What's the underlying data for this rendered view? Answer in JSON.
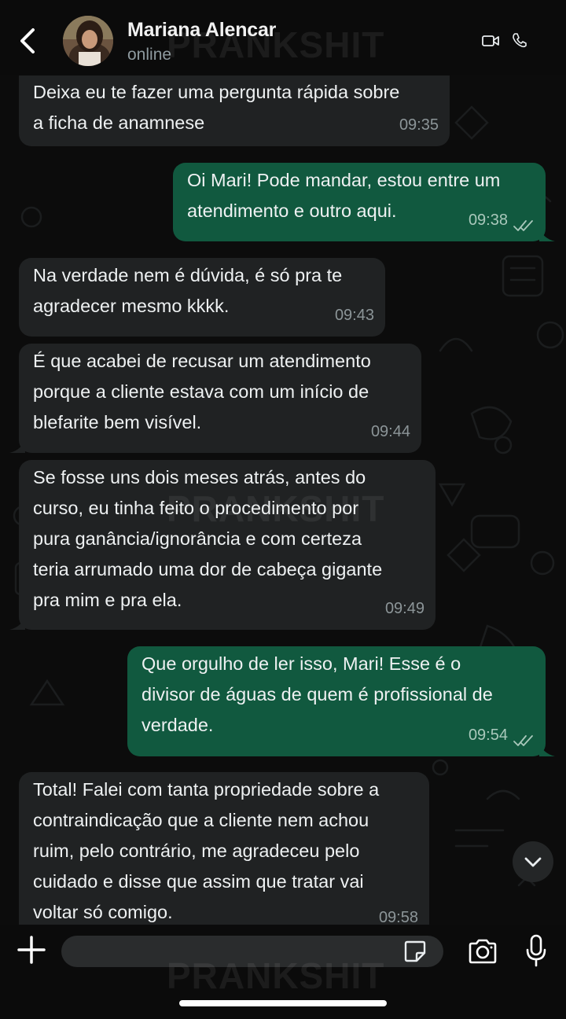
{
  "header": {
    "contact_name": "Mariana Alencar",
    "status": "online"
  },
  "watermark": "PRANKSHIT",
  "messages": [
    {
      "direction": "in",
      "lines": [
        "Deixa eu te fazer uma pergunta rápida sobre",
        "a ficha de anamnese"
      ],
      "time": "09:35"
    },
    {
      "direction": "out",
      "lines": [
        "Oi Mari! Pode mandar, estou entre um",
        "atendimento e outro aqui."
      ],
      "time": "09:38",
      "status": "read"
    },
    {
      "direction": "in",
      "lines": [
        "Na verdade nem é dúvida, é só pra te",
        "agradecer mesmo kkkk."
      ],
      "time": "09:43"
    },
    {
      "direction": "in",
      "lines": [
        "É que acabei de recusar um atendimento",
        "porque a cliente estava com um início de",
        "blefarite bem visível."
      ],
      "time": "09:44"
    },
    {
      "direction": "in",
      "lines": [
        "Se fosse uns dois meses atrás, antes do",
        "curso, eu tinha feito o procedimento por",
        "pura ganância/ignorância e com certeza",
        "teria arrumado uma dor de cabeça gigante",
        "pra mim e pra ela."
      ],
      "time": "09:49"
    },
    {
      "direction": "out",
      "lines": [
        "Que orgulho de ler isso, Mari! Esse é o",
        "divisor de águas de quem é profissional de",
        "verdade."
      ],
      "time": "09:54",
      "status": "read"
    },
    {
      "direction": "in",
      "lines": [
        "Total! Falei com tanta propriedade sobre a",
        "contraindicação que a cliente nem achou",
        "ruim, pelo contrário, me agradeceu pelo",
        "cuidado e disse que assim que tratar vai",
        "voltar só comigo."
      ],
      "time": "09:58"
    }
  ],
  "input": {
    "value": "",
    "placeholder": ""
  },
  "colors": {
    "incoming_bubble": "#202223",
    "outgoing_bubble": "#11593f",
    "background": "#0b0b0b"
  },
  "icons": {
    "back": "chevron-left-icon",
    "video": "video-camera-icon",
    "call": "phone-icon",
    "attach": "plus-icon",
    "sticker": "sticker-icon",
    "camera": "camera-icon",
    "mic": "microphone-icon",
    "scroll": "chevron-down-icon",
    "read_receipt": "double-check-icon"
  }
}
